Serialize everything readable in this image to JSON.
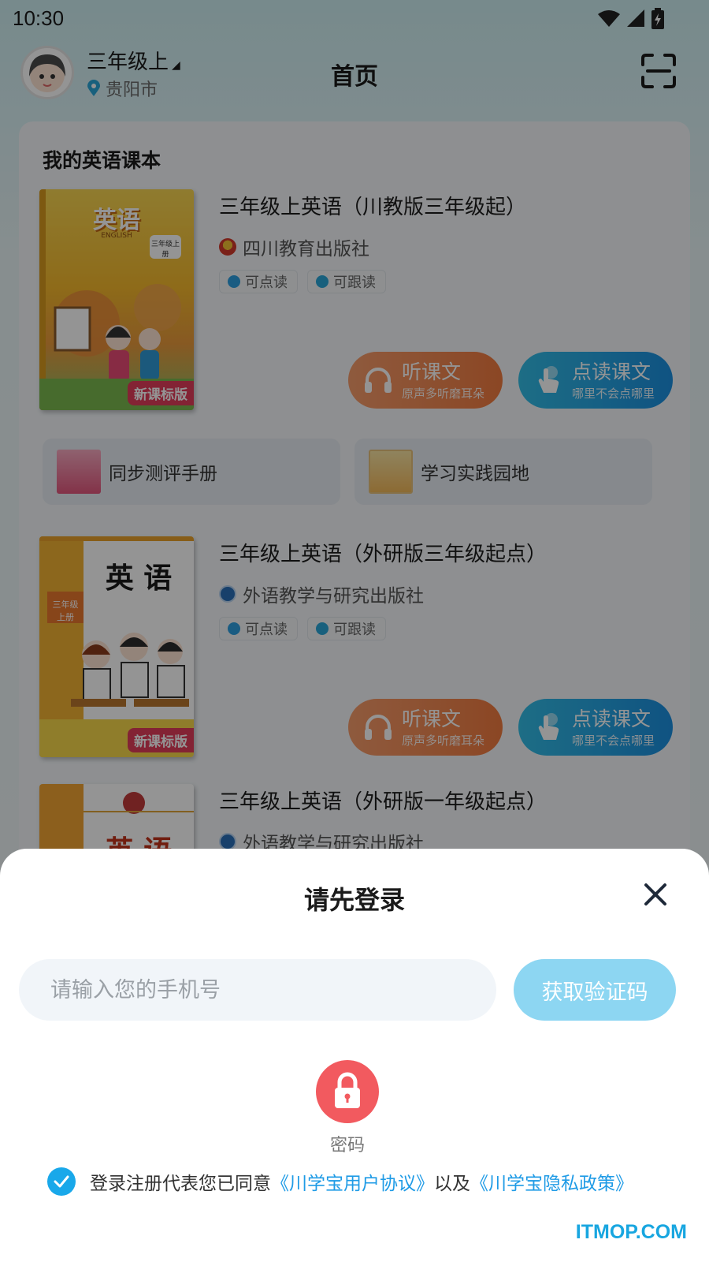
{
  "status_bar": {
    "time": "10:30"
  },
  "header": {
    "grade": "三年级上",
    "city": "贵阳市",
    "title": "首页"
  },
  "section": {
    "title": "我的英语课本"
  },
  "books": [
    {
      "title": "三年级上英语（川教版三年级起）",
      "publisher": "四川教育出版社",
      "tags": [
        "可点读",
        "可跟读"
      ],
      "listen": {
        "label": "听课文",
        "sub": "原声多听磨耳朵"
      },
      "read": {
        "label": "点读课文",
        "sub": "哪里不会点哪里"
      },
      "cover_title": "英语",
      "cover_sub": "ENGLISH",
      "cover_badge": "三年级上册",
      "cover_ribbon": "新课标版"
    },
    {
      "title": "三年级上英语（外研版三年级起点）",
      "publisher": "外语教学与研究出版社",
      "tags": [
        "可点读",
        "可跟读"
      ],
      "listen": {
        "label": "听课文",
        "sub": "原声多听磨耳朵"
      },
      "read": {
        "label": "点读课文",
        "sub": "哪里不会点哪里"
      },
      "cover_title": "英 语",
      "cover_badge": "三年级 上册",
      "cover_ribbon": "新课标版"
    },
    {
      "title": "三年级上英语（外研版一年级起点）",
      "publisher": "外语教学与研究出版社",
      "cover_title": "英 语"
    }
  ],
  "aux_links": [
    {
      "label": "同步测评手册"
    },
    {
      "label": "学习实践园地"
    }
  ],
  "login": {
    "title": "请先登录",
    "phone_placeholder": "请输入您的手机号",
    "code_button": "获取验证码",
    "password_label": "密码",
    "agree_prefix": "登录注册代表您已同意",
    "user_agreement": "《川学宝用户协议》",
    "and": "以及",
    "privacy_policy": "《川学宝隐私政策》"
  },
  "watermark": "ITMOP.COM",
  "colors": {
    "accent_blue": "#19a8ea",
    "listen_orange": "#f07a3f",
    "lock_red": "#f25a5f",
    "code_button": "#8dd6f2"
  }
}
